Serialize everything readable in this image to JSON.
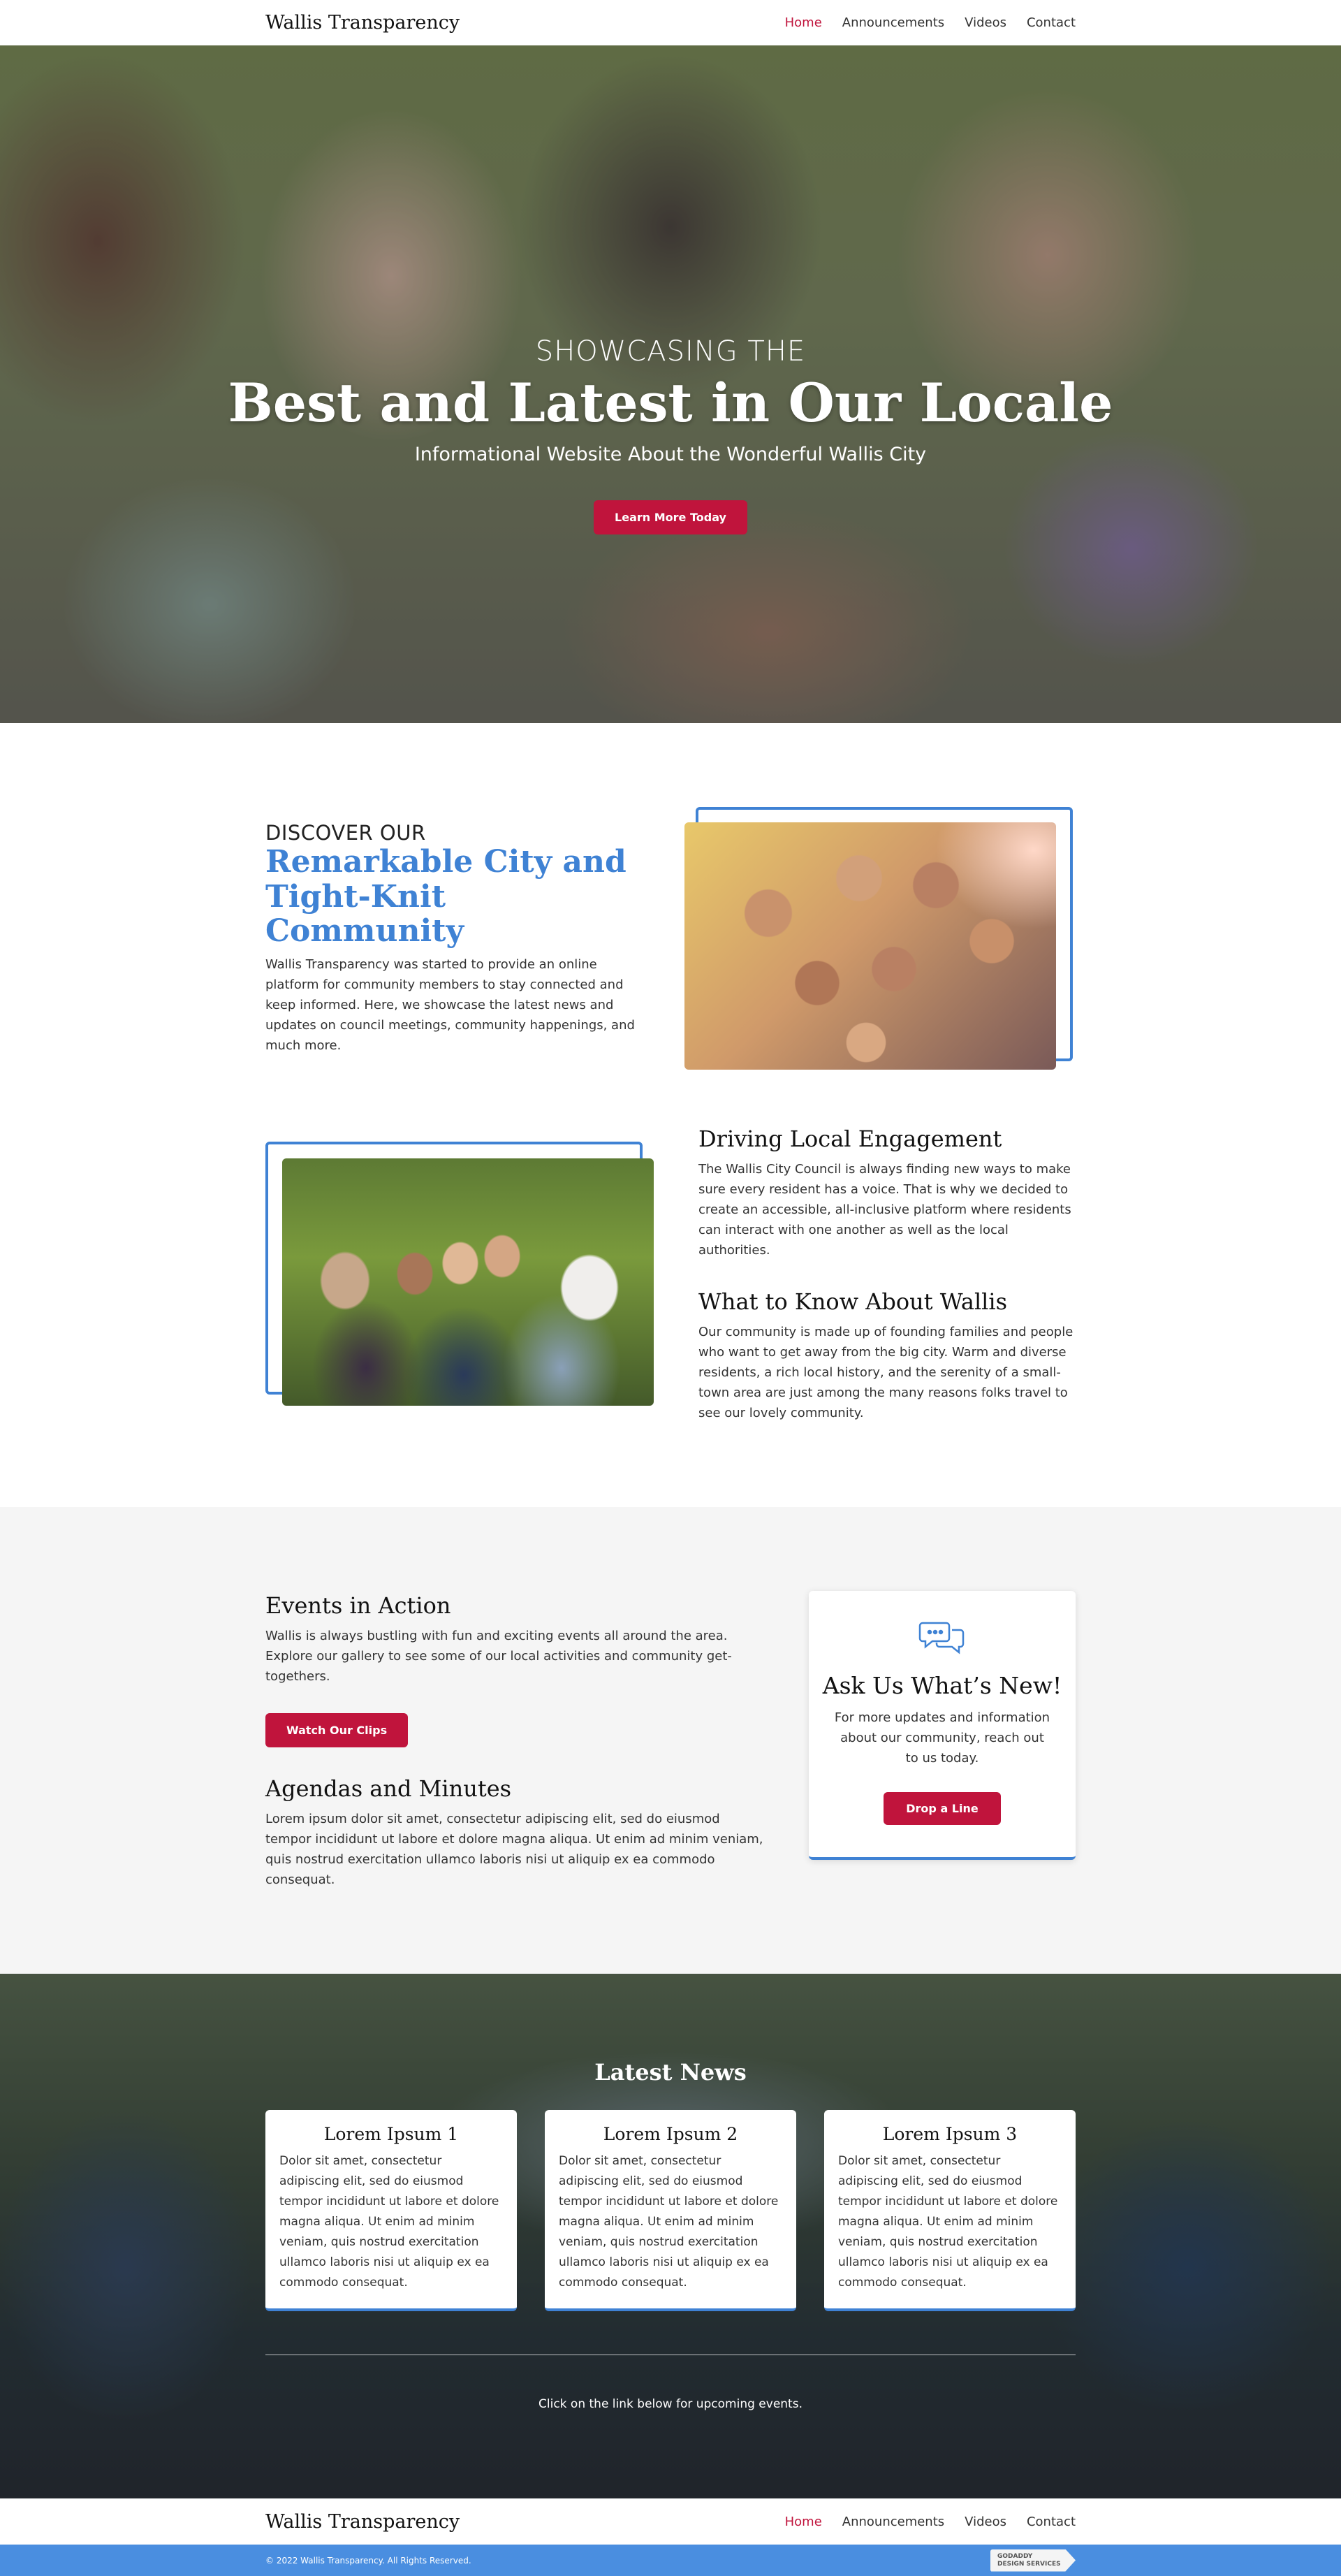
{
  "header": {
    "brand": "Wallis Transparency",
    "nav": [
      {
        "label": "Home",
        "active": true
      },
      {
        "label": "Announcements"
      },
      {
        "label": "Videos"
      },
      {
        "label": "Contact"
      }
    ]
  },
  "hero": {
    "pre": "SHOWCASING THE",
    "title": "Best and Latest in Our Locale",
    "subtitle": "Informational Website About the Wonderful Wallis City",
    "button": "Learn More Today"
  },
  "intro": {
    "pre": "DISCOVER OUR",
    "title_line1": "Remarkable City and",
    "title_line2": "Tight-Knit Community",
    "text": "Wallis Transparency was started to provide an online platform for community members to stay connected and keep informed. Here, we showcase the latest news and updates on council meetings, community happenings, and much more."
  },
  "engagement": {
    "title": "Driving Local Engagement",
    "text": "The Wallis City Council is always finding new ways to make sure every resident has a voice. That is why we decided to create an accessible, all-inclusive platform where residents can interact with one another as well as the local authorities."
  },
  "know": {
    "title": "What to Know About Wallis",
    "text": "Our community is made up of founding families and people who want to get away from the big city. Warm and diverse residents, a rich local history, and the serenity of a small-town area are just among the many reasons folks travel to see our lovely community."
  },
  "events": {
    "title": "Events in Action",
    "text": "Wallis is always bustling with fun and exciting events all around the area. Explore our gallery to see some of our local activities and community get-togethers.",
    "button": "Watch Our Clips"
  },
  "agendas": {
    "title": "Agendas and Minutes",
    "text": "Lorem ipsum dolor sit amet, consectetur adipiscing elit, sed do eiusmod tempor incididunt ut labore et dolore magna aliqua. Ut enim ad minim veniam, quis nostrud exercitation ullamco laboris nisi ut aliquip ex ea commodo consequat."
  },
  "ask": {
    "icon": "chat-bubbles-icon",
    "title": "Ask Us What’s New!",
    "text": "For more updates and information about our community, reach out to us today.",
    "button": "Drop a Line"
  },
  "news": {
    "title": "Latest News",
    "cards": [
      {
        "title": "Lorem Ipsum 1",
        "text": "Dolor sit amet, consectetur adipiscing elit, sed do eiusmod tempor incididunt ut labore et dolore magna aliqua. Ut enim ad minim veniam, quis nostrud exercitation ullamco laboris nisi ut aliquip ex ea commodo consequat."
      },
      {
        "title": "Lorem Ipsum 2",
        "text": "Dolor sit amet, consectetur adipiscing elit, sed do eiusmod tempor incididunt ut labore et dolore magna aliqua. Ut enim ad minim veniam, quis nostrud exercitation ullamco laboris nisi ut aliquip ex ea commodo consequat."
      },
      {
        "title": "Lorem Ipsum 3",
        "text": "Dolor sit amet, consectetur adipiscing elit, sed do eiusmod tempor incididunt ut labore et dolore magna aliqua. Ut enim ad minim veniam, quis nostrud exercitation ullamco laboris nisi ut aliquip ex ea commodo consequat."
      }
    ],
    "link_text": "Click on the link below for upcoming events."
  },
  "footer": {
    "brand": "Wallis Transparency",
    "nav": [
      {
        "label": "Home",
        "active": true
      },
      {
        "label": "Announcements"
      },
      {
        "label": "Videos"
      },
      {
        "label": "Contact"
      }
    ],
    "copyright": "© 2022 Wallis Transparency. All Rights Reserved.",
    "badge_line1": "GODADDY",
    "badge_line2": "DESIGN SERVICES"
  },
  "colors": {
    "accent_red": "#c0143c",
    "accent_blue": "#3f82d4",
    "footer_bar": "#4a8ee0"
  }
}
